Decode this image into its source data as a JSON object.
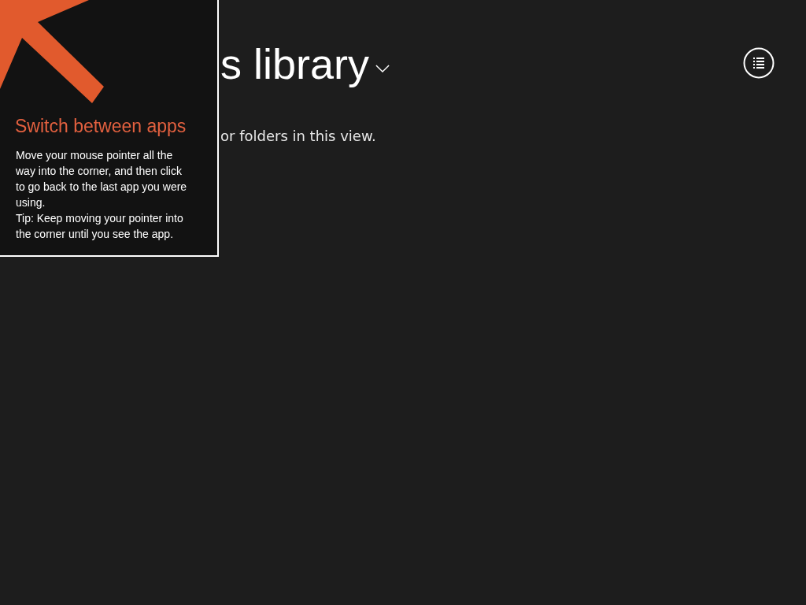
{
  "page": {
    "title": "s library",
    "message": "or folders in this view."
  },
  "tip": {
    "title": "Switch between apps",
    "paragraphs": [
      "Move your mouse pointer all the way into the corner, and then click to go back to the last app you were using.",
      "Tip: Keep moving your pointer into the corner until you see the app."
    ]
  }
}
